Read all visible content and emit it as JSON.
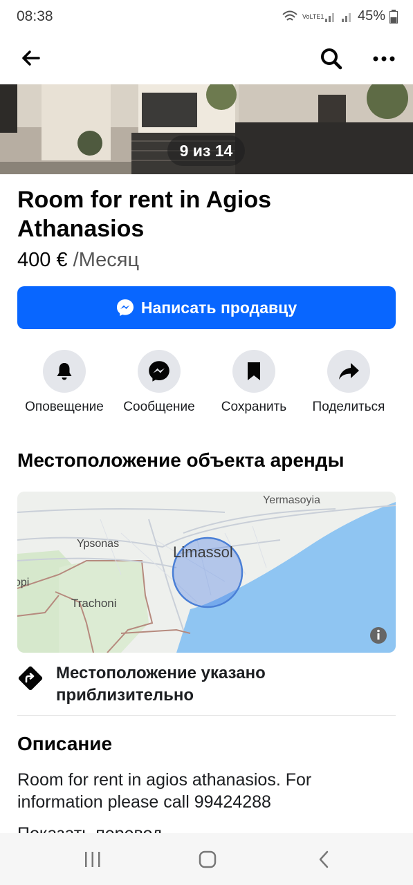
{
  "status_bar": {
    "time": "08:38",
    "network_label": "VoLTE1",
    "battery": "45%"
  },
  "app_bar": {
    "back_icon": "arrow-left-icon",
    "search_icon": "search-icon",
    "more_icon": "more-dots-icon"
  },
  "photo": {
    "counter": "9 из 14"
  },
  "listing": {
    "title": "Room for rent in Agios Athanasios",
    "price": "400 €",
    "period": "/Месяц"
  },
  "message_button": {
    "label": "Написать продавцу",
    "icon": "messenger-icon"
  },
  "actions": [
    {
      "label": "Оповещение",
      "icon": "bell-icon"
    },
    {
      "label": "Сообщение",
      "icon": "messenger-icon"
    },
    {
      "label": "Сохранить",
      "icon": "bookmark-icon"
    },
    {
      "label": "Поделиться",
      "icon": "share-icon"
    }
  ],
  "location": {
    "heading": "Местоположение объекта аренды",
    "map_labels": {
      "city": "Limassol",
      "town1": "Yermasoyia",
      "town2": "Ypsonas",
      "town3": "Trachoni",
      "partial": "opi"
    },
    "approx_line1": "Местоположение указано",
    "approx_line2": "приблизительно"
  },
  "description": {
    "heading": "Описание",
    "text": "Room for rent in agios athanasios. For information please call 99424288",
    "cutoff_text": "Показать перевод"
  },
  "colors": {
    "accent": "#0866ff",
    "action_bg": "#e4e6eb",
    "sea": "#8fc5f2"
  }
}
